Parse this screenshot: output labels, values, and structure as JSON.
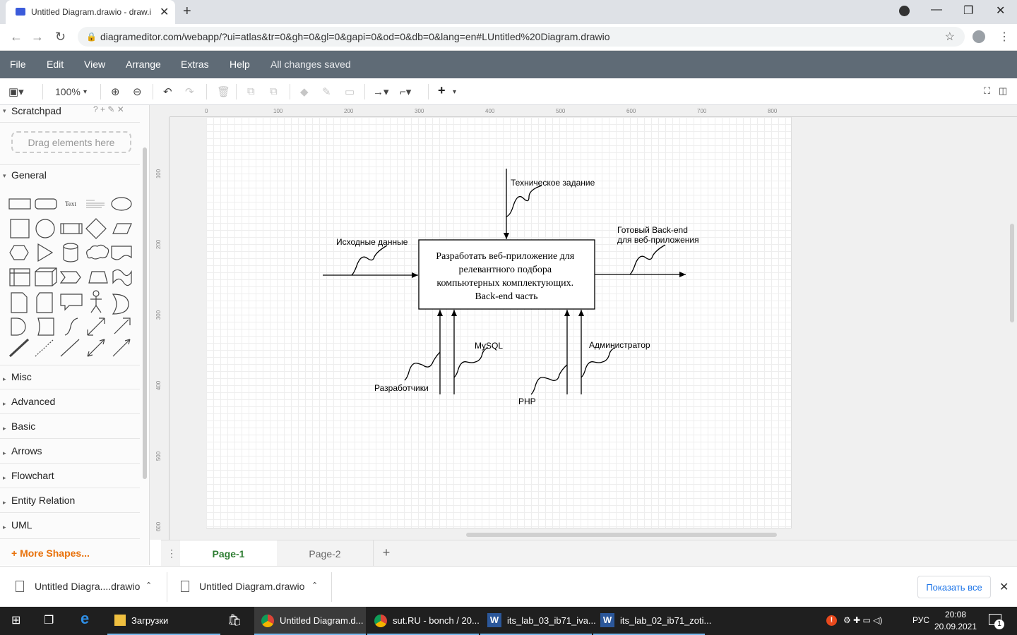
{
  "browser": {
    "tab_title": "Untitled Diagram.drawio - draw.io",
    "url": "diagrameditor.com/webapp/?ui=atlas&tr=0&gh=0&gl=0&gapi=0&od=0&db=0&lang=en#LUntitled%20Diagram.drawio"
  },
  "menu": {
    "file": "File",
    "edit": "Edit",
    "view": "View",
    "arrange": "Arrange",
    "extras": "Extras",
    "help": "Help",
    "status": "All changes saved"
  },
  "toolbar": {
    "zoom": "100%"
  },
  "sidebar": {
    "scratchpad": "Scratchpad",
    "scratchpad_tools": "? + ✎ ✕",
    "drag_hint": "Drag elements here",
    "general": "General",
    "text_shape": "Text",
    "sections": [
      "Misc",
      "Advanced",
      "Basic",
      "Arrows",
      "Flowchart",
      "Entity Relation",
      "UML"
    ],
    "more_shapes": "More Shapes..."
  },
  "ruler": {
    "top": [
      "0",
      "100",
      "200",
      "300",
      "400",
      "500",
      "600",
      "700",
      "800"
    ],
    "left": [
      "100",
      "200",
      "300",
      "400",
      "500",
      "600"
    ]
  },
  "diagram": {
    "box_lines": [
      "Разработать веб-приложение для",
      "релевантного подбора",
      "компьютерных комплектующих.",
      "Back-end часть"
    ],
    "control": "Техническое задание",
    "input": "Исходные данные",
    "output_lines": [
      "Готовый Back-end",
      "для веб-приложения"
    ],
    "mech1": "Разработчики",
    "mech2": "MySQL",
    "mech3": "PHP",
    "mech4": "Администратор"
  },
  "pages": {
    "page1": "Page-1",
    "page2": "Page-2",
    "add": "+"
  },
  "downloads": {
    "file1": "Untitled Diagra....drawio",
    "file2": "Untitled Diagram.drawio",
    "show_all": "Показать все"
  },
  "taskbar": {
    "explorer": "Загрузки",
    "chrome1": "Untitled Diagram.d...",
    "chrome2": "sut.RU - bonch / 20...",
    "word1": "its_lab_03_ib71_iva...",
    "word2": "its_lab_02_ib71_zoti...",
    "lang": "РУС",
    "time": "20:08",
    "date": "20.09.2021",
    "notif_count": "1"
  }
}
